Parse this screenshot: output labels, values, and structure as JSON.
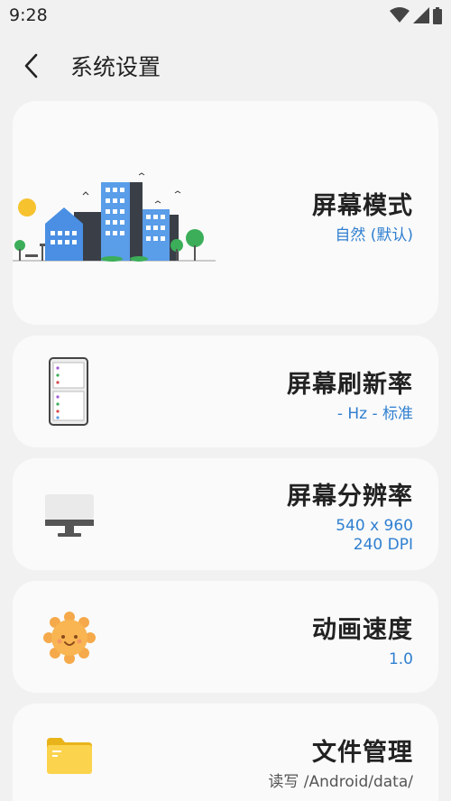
{
  "status_bar": {
    "time": "9:28"
  },
  "app_bar": {
    "title": "系统设置"
  },
  "cards": [
    {
      "title": "屏幕模式",
      "subtitle": "自然 (默认)"
    },
    {
      "title": "屏幕刷新率",
      "subtitle": "- Hz - 标准"
    },
    {
      "title": "屏幕分辨率",
      "subtitle_lines": [
        "540 x 960",
        "240 DPI"
      ]
    },
    {
      "title": "动画速度",
      "subtitle": "1.0"
    },
    {
      "title": "文件管理",
      "subtitle": "读写 /Android/data/"
    }
  ],
  "colors": {
    "accent": "#2f7fd0",
    "background": "#f1f1f1",
    "card": "#fafafa"
  }
}
